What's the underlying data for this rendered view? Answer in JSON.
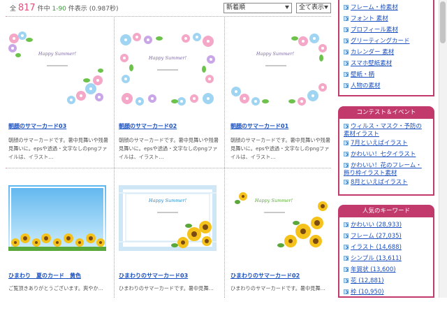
{
  "results": {
    "prefix": "全",
    "total": "817",
    "suffix1": "件中",
    "range": "1-90",
    "suffix2": "件表示",
    "time": "(0.987秒)"
  },
  "sort": {
    "selected": "新着順"
  },
  "show": {
    "selected": "全て表示"
  },
  "cards": [
    {
      "title": "朝顔のサマーカード03",
      "desc": "朝顔のサマーカードです。暑中見舞いや残暑見舞いに。epsや透過・文字なしのpngファイルは、イラスト…",
      "thumb_text": "Happy Summer!"
    },
    {
      "title": "朝顔のサマーカード02",
      "desc": "朝顔のサマーカードです。暑中見舞いや残暑見舞いに。epsや透過・文字なしのpngファイルは、イラスト…",
      "thumb_text": "Happy Summer!"
    },
    {
      "title": "朝顔のサマーカード01",
      "desc": "朝顔のサマーカードです。暑中見舞いや残暑見舞いに。epsや透過・文字なしのpngファイルは、イラスト…",
      "thumb_text": "Happy Summer!"
    },
    {
      "title": "ひまわり　夏のカード　黄色",
      "desc": "ご覧頂きありがとうございます。爽やか…",
      "thumb_text": ""
    },
    {
      "title": "ひまわりのサマーカード03",
      "desc": "ひまわりのサマーカードです。暑中見舞…",
      "thumb_text": "Happy Summer!"
    },
    {
      "title": "ひまわりのサマーカード02",
      "desc": "ひまわりのサマーカードです。暑中見舞…",
      "thumb_text": "Happy Summer!"
    }
  ],
  "sidebar": {
    "category_links": [
      "フレーム・枠素材",
      "フォント 素材",
      "プロフィール素材",
      "グリーティングカード",
      "カレンダー 素材",
      "スマホ壁紙素材",
      "壁紙・柄",
      "人物の素材"
    ],
    "contest": {
      "title": "コンテスト＆イベント",
      "links": [
        "ウィルス・マスク・予防の素材イラスト",
        "7月といえばイラスト",
        "かわいい！七夕イラスト",
        "かわいい！花のフレーム・飾り枠イラスト素材",
        "8月といえばイラスト"
      ]
    },
    "keywords": {
      "title": "人気のキーワード",
      "links": [
        "かわいい (28,933)",
        "フレーム (27,035)",
        "イラスト (14,688)",
        "シンプル (13,611)",
        "年賀状 (13,600)",
        "花 (12,881)",
        "枠 (10,950)"
      ]
    }
  },
  "colors": {
    "accent": "#c13a6b",
    "link": "#1a4fbf",
    "divider": "#e08aa8"
  },
  "icons": {
    "list_bullet": "arrow-right-icon"
  }
}
